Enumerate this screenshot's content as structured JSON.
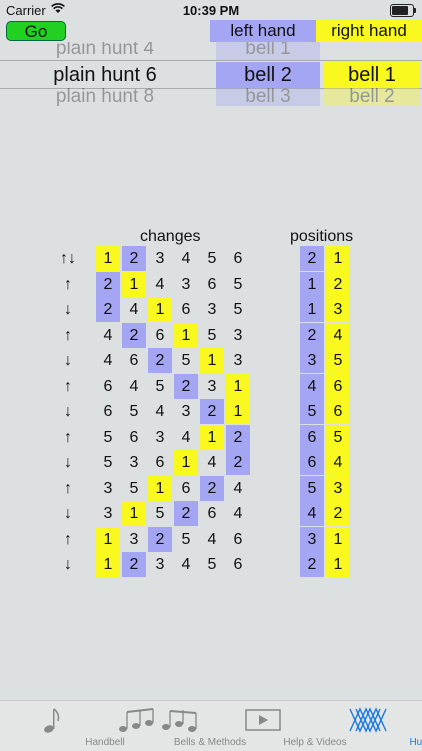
{
  "status": {
    "carrier": "Carrier",
    "time": "10:39 PM"
  },
  "go_label": "Go",
  "headers": {
    "left": "left hand",
    "right": "right hand"
  },
  "picker": {
    "rows": [
      {
        "method": "plain hunt 4",
        "left": "bell 1",
        "right": ""
      },
      {
        "method": "plain hunt 6",
        "left": "bell 2",
        "right": "bell 1"
      },
      {
        "method": "plain hunt 8",
        "left": "bell 3",
        "right": "bell 2"
      }
    ]
  },
  "changes_title": "changes",
  "positions_title": "positions",
  "left_bell": 2,
  "right_bell": 1,
  "rows": [
    {
      "arrow": "↑↓",
      "bells": [
        1,
        2,
        3,
        4,
        5,
        6
      ],
      "positions": [
        2,
        1
      ]
    },
    {
      "arrow": "↑",
      "bells": [
        2,
        1,
        4,
        3,
        6,
        5
      ],
      "positions": [
        1,
        2
      ]
    },
    {
      "arrow": "↓",
      "bells": [
        2,
        4,
        1,
        6,
        3,
        5
      ],
      "positions": [
        1,
        3
      ]
    },
    {
      "arrow": "↑",
      "bells": [
        4,
        2,
        6,
        1,
        5,
        3
      ],
      "positions": [
        2,
        4
      ]
    },
    {
      "arrow": "↓",
      "bells": [
        4,
        6,
        2,
        5,
        1,
        3
      ],
      "positions": [
        3,
        5
      ]
    },
    {
      "arrow": "↑",
      "bells": [
        6,
        4,
        5,
        2,
        3,
        1
      ],
      "positions": [
        4,
        6
      ]
    },
    {
      "arrow": "↓",
      "bells": [
        6,
        5,
        4,
        3,
        2,
        1
      ],
      "positions": [
        5,
        6
      ]
    },
    {
      "arrow": "↑",
      "bells": [
        5,
        6,
        3,
        4,
        1,
        2
      ],
      "positions": [
        6,
        5
      ]
    },
    {
      "arrow": "↓",
      "bells": [
        5,
        3,
        6,
        1,
        4,
        2
      ],
      "positions": [
        6,
        4
      ]
    },
    {
      "arrow": "↑",
      "bells": [
        3,
        5,
        1,
        6,
        2,
        4
      ],
      "positions": [
        5,
        3
      ]
    },
    {
      "arrow": "↓",
      "bells": [
        3,
        1,
        5,
        2,
        6,
        4
      ],
      "positions": [
        4,
        2
      ]
    },
    {
      "arrow": "↑",
      "bells": [
        1,
        3,
        2,
        5,
        4,
        6
      ],
      "positions": [
        3,
        1
      ]
    },
    {
      "arrow": "↓",
      "bells": [
        1,
        2,
        3,
        4,
        5,
        6
      ],
      "positions": [
        2,
        1
      ]
    }
  ],
  "tabs": [
    {
      "label": "Handbell",
      "icon": "music-note-icon"
    },
    {
      "label": "Bells & Methods",
      "icon": "music-notes-icon"
    },
    {
      "label": "Help & Videos",
      "icon": "video-icon"
    },
    {
      "label": "Hunt",
      "icon": "hunt-lattice-icon"
    }
  ],
  "colors": {
    "left": "#a4a5f3",
    "right": "#f9f920",
    "active_tab": "#1a7ae0"
  }
}
